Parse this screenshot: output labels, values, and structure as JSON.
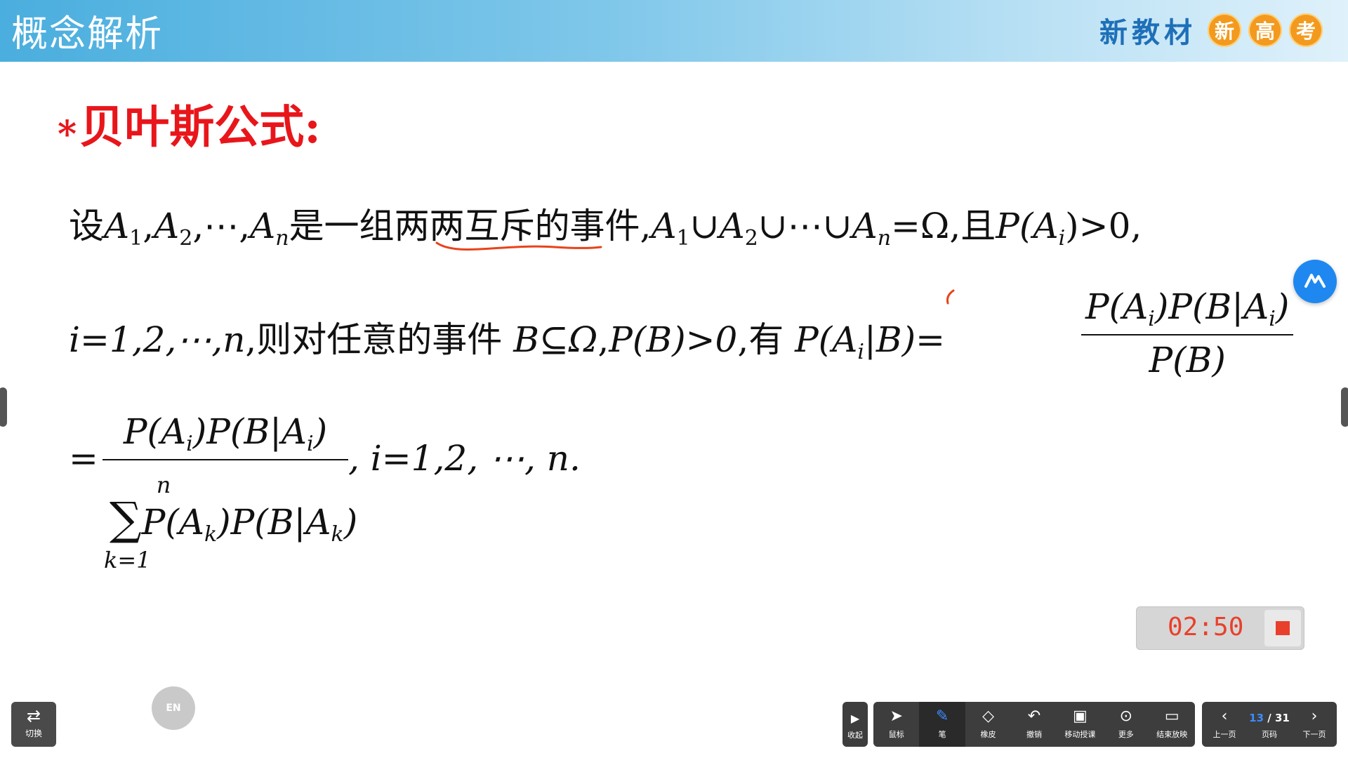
{
  "header": {
    "title": "概念解析",
    "brand_text": "新教材",
    "brand_badges": [
      "新",
      "高",
      "考"
    ]
  },
  "slide": {
    "section_title": "贝叶斯公式:",
    "star": "*",
    "line1": {
      "t1": "设",
      "a": "A",
      "s1": "1",
      "s2": "2",
      "sn": "n",
      "comma": ",",
      "dots": "⋯",
      "t2": "是一组",
      "underlined": "两两互斥",
      "t3": "的事件,",
      "union": "∪",
      "eq_omega": "=Ω",
      "t4": ",且",
      "cond": "P(A",
      "si": "i",
      "cond_end": ")>0,"
    },
    "line2": {
      "i_eq": "i=1,2,⋯,n",
      "t1": ",则对任意的事件",
      "b_subset": "B⊆Ω",
      "t2": ",",
      "pb_pos": "P(B)>0",
      "t3": ",有",
      "lhs": "P(A",
      "si": "i",
      "lhs_end": "|B)=",
      "num1": "P(A",
      "num1_end": ")P(B|A",
      "num1_close": ")",
      "den1": "P(B)"
    },
    "line3": {
      "eq": "=",
      "num": "P(A",
      "num_mid": ")P(B|A",
      "num_close": ")",
      "tail": ", i=1,2, ⋯, n.",
      "sum_upper": "n",
      "sum_sigma": "∑",
      "sum_body": "P(A",
      "sk": "k",
      "sum_mid": ")P(B|A",
      "sum_close": ")",
      "sum_lower": "k=1"
    }
  },
  "timer": {
    "value": "02:50"
  },
  "widgets": {
    "lang_bubble": "EN"
  },
  "toolbar": {
    "switch": "切换",
    "collapse": "收起",
    "tools": [
      {
        "label": "鼠标",
        "icon": "cursor-icon"
      },
      {
        "label": "笔",
        "icon": "pen-icon"
      },
      {
        "label": "橡皮",
        "icon": "eraser-icon"
      },
      {
        "label": "撤销",
        "icon": "undo-icon"
      },
      {
        "label": "移动授课",
        "icon": "mobile-teach-icon"
      },
      {
        "label": "更多",
        "icon": "more-icon"
      },
      {
        "label": "结束放映",
        "icon": "end-show-icon"
      }
    ],
    "prev": "上一页",
    "page_label": "页码",
    "page_current": "13",
    "page_total": "/ 31",
    "next": "下一页"
  },
  "colors": {
    "title_red": "#e8161b",
    "header_blue": "#4aaede",
    "brand_orange": "#f39a1e",
    "timer_red": "#e9402b",
    "active_blue": "#3b8cff"
  }
}
